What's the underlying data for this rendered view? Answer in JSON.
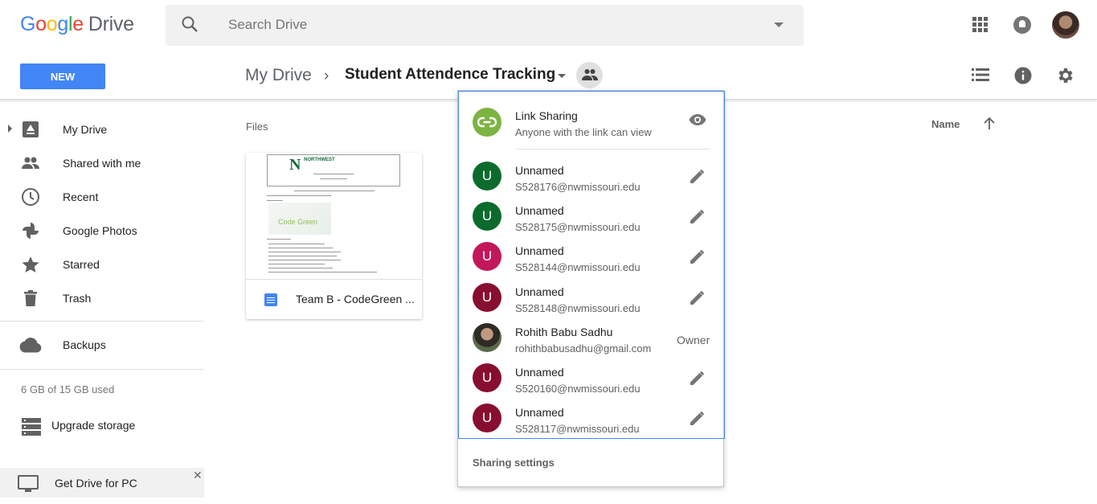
{
  "app": {
    "logo_google": "Google",
    "logo_product": "Drive"
  },
  "search": {
    "placeholder": "Search Drive"
  },
  "toolbar": {
    "new_label": "NEW",
    "breadcrumb_root": "My Drive",
    "breadcrumb_sep": "›",
    "breadcrumb_current": "Student Attendence Tracking"
  },
  "sidebar": {
    "items": [
      {
        "label": "My Drive",
        "icon": "drive-icon"
      },
      {
        "label": "Shared with me",
        "icon": "people-icon"
      },
      {
        "label": "Recent",
        "icon": "clock-icon"
      },
      {
        "label": "Google Photos",
        "icon": "pinwheel-icon"
      },
      {
        "label": "Starred",
        "icon": "star-icon"
      },
      {
        "label": "Trash",
        "icon": "trash-icon"
      }
    ],
    "backups_label": "Backups",
    "storage_text": "6 GB of 15 GB used",
    "upgrade_label": "Upgrade storage",
    "get_drive_label": "Get Drive for PC",
    "close_glyph": "✕"
  },
  "main": {
    "files_label": "Files",
    "sort_label": "Name",
    "file": {
      "name": "Team B - CodeGreen ...",
      "thumb_brand": "NORTHWEST",
      "thumb_logo_text": "Code Green"
    }
  },
  "share_popup": {
    "link_title": "Link Sharing",
    "link_sub": "Anyone with the link can view",
    "people": [
      {
        "initial": "U",
        "name": "Unnamed",
        "email": "S528176@nwmissouri.edu",
        "color": "#0b6b2c",
        "role": "edit"
      },
      {
        "initial": "U",
        "name": "Unnamed",
        "email": "S528175@nwmissouri.edu",
        "color": "#0b6b2c",
        "role": "edit"
      },
      {
        "initial": "U",
        "name": "Unnamed",
        "email": "S528144@nwmissouri.edu",
        "color": "#c2185b",
        "role": "edit"
      },
      {
        "initial": "U",
        "name": "Unnamed",
        "email": "S528148@nwmissouri.edu",
        "color": "#880e2f",
        "role": "edit"
      },
      {
        "initial": "",
        "name": "Rohith Babu Sadhu",
        "email": "rohithbabusadhu@gmail.com",
        "color": "",
        "role": "Owner"
      },
      {
        "initial": "U",
        "name": "Unnamed",
        "email": "S520160@nwmissouri.edu",
        "color": "#880e2f",
        "role": "edit"
      },
      {
        "initial": "U",
        "name": "Unnamed",
        "email": "S528117@nwmissouri.edu",
        "color": "#880e2f",
        "role": "edit"
      }
    ],
    "settings_label": "Sharing settings"
  }
}
